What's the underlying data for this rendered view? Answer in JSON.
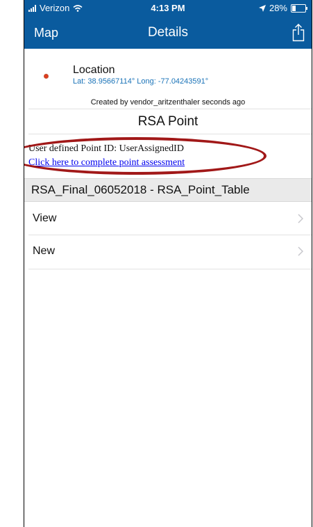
{
  "status_bar": {
    "carrier": "Verizon",
    "time": "4:13 PM",
    "battery": "28%",
    "battery_level": 0.28
  },
  "nav": {
    "back_label": "Map",
    "title": "Details",
    "share_icon": "share-icon"
  },
  "location": {
    "label": "Location",
    "coords": "Lat: 38.95667114° Long: -77.04243591°",
    "created": "Created by vendor_aritzenthaler seconds ago"
  },
  "feature": {
    "title": "RSA Point",
    "description": "User defined Point ID: UserAssignedID",
    "link": "Click here to complete point assessment"
  },
  "table": {
    "header": "RSA_Final_06052018 - RSA_Point_Table",
    "rows": [
      {
        "label": "View"
      },
      {
        "label": "New"
      }
    ]
  },
  "colors": {
    "bar": "#0a5b9e",
    "annotation": "#a11818",
    "link": "#0000ee"
  }
}
